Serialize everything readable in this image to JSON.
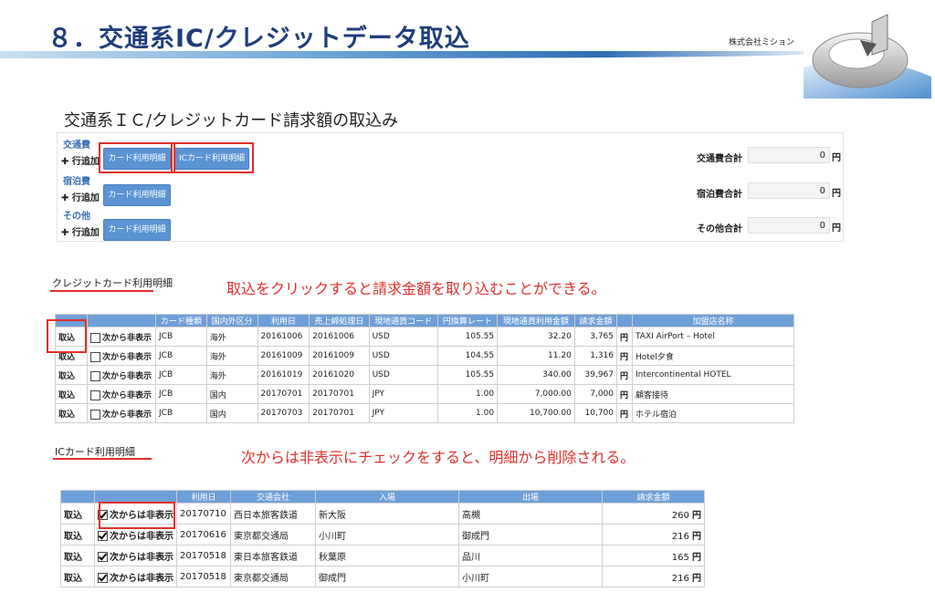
{
  "slide": {
    "title": "８．交通系IC/クレジットデータ取込",
    "company": "株式会社ミション"
  },
  "panel": {
    "title": "交通系ＩＣ/クレジットカード請求額の取込み",
    "categories": [
      {
        "label": "交通費",
        "add": "✚ 行追加",
        "buttons": [
          "カード利用明細",
          "ICカード利用明細"
        ],
        "total_label": "交通費合計",
        "total_value": "0",
        "unit": "円"
      },
      {
        "label": "宿泊費",
        "add": "✚ 行追加",
        "buttons": [
          "カード利用明細"
        ],
        "total_label": "宿泊費合計",
        "total_value": "0",
        "unit": "円"
      },
      {
        "label": "その他",
        "add": "✚ 行追加",
        "buttons": [
          "カード利用明細"
        ],
        "total_label": "その他合計",
        "total_value": "0",
        "unit": "円"
      }
    ]
  },
  "credit": {
    "title": "クレジットカード利用明細",
    "note": "取込をクリックすると請求金額を取り込むことができる。",
    "headers": [
      "",
      "",
      "カード種類",
      "国内外区分",
      "利用日",
      "売上締処理日",
      "現地通貨コード",
      "円換算レート",
      "現地通貨利用金額",
      "請求金額",
      "",
      "加盟店名称"
    ],
    "rows": [
      {
        "action": "取込",
        "hide": "次から非表示",
        "card": "JCB",
        "region": "海外",
        "date": "20161006",
        "close": "20161006",
        "currency": "USD",
        "rate": "105.55",
        "local": "32.20",
        "amount": "3,765",
        "unit": "円",
        "store": "TAXI AirPort – Hotel"
      },
      {
        "action": "取込",
        "hide": "次から非表示",
        "card": "JCB",
        "region": "海外",
        "date": "20161009",
        "close": "20161009",
        "currency": "USD",
        "rate": "104.55",
        "local": "11.20",
        "amount": "1,316",
        "unit": "円",
        "store": "Hotel夕食"
      },
      {
        "action": "取込",
        "hide": "次から非表示",
        "card": "JCB",
        "region": "海外",
        "date": "20161019",
        "close": "20161020",
        "currency": "USD",
        "rate": "105.55",
        "local": "340.00",
        "amount": "39,967",
        "unit": "円",
        "store": "Intercontinental HOTEL"
      },
      {
        "action": "取込",
        "hide": "次から非表示",
        "card": "JCB",
        "region": "国内",
        "date": "20170701",
        "close": "20170701",
        "currency": "JPY",
        "rate": "1.00",
        "local": "7,000.00",
        "amount": "7,000",
        "unit": "円",
        "store": "顧客接待"
      },
      {
        "action": "取込",
        "hide": "次から非表示",
        "card": "JCB",
        "region": "国内",
        "date": "20170703",
        "close": "20170701",
        "currency": "JPY",
        "rate": "1.00",
        "local": "10,700.00",
        "amount": "10,700",
        "unit": "円",
        "store": "ホテル宿泊"
      }
    ]
  },
  "ic": {
    "title": "ICカード利用明細",
    "note": "次からは非表示にチェックをすると、明細から削除される。",
    "headers": [
      "",
      "",
      "利用日",
      "交通会社",
      "入場",
      "出場",
      "請求金額"
    ],
    "rows": [
      {
        "action": "取込",
        "hide": "次からは非表示",
        "date": "20170710",
        "company": "西日本旅客鉄道",
        "in": "新大阪",
        "out": "高槻",
        "amount": "260",
        "unit": "円"
      },
      {
        "action": "取込",
        "hide": "次からは非表示",
        "date": "20170616",
        "company": "東京都交通局",
        "in": "小川町",
        "out": "御成門",
        "amount": "216",
        "unit": "円"
      },
      {
        "action": "取込",
        "hide": "次からは非表示",
        "date": "20170518",
        "company": "東日本旅客鉄道",
        "in": "秋葉原",
        "out": "品川",
        "amount": "165",
        "unit": "円"
      },
      {
        "action": "取込",
        "hide": "次からは非表示",
        "date": "20170518",
        "company": "東京都交通局",
        "in": "御成門",
        "out": "小川町",
        "amount": "216",
        "unit": "円"
      }
    ]
  },
  "colors": {
    "accent": "#5b93d3",
    "highlight": "#e0302a",
    "title": "#1f3d7a"
  }
}
